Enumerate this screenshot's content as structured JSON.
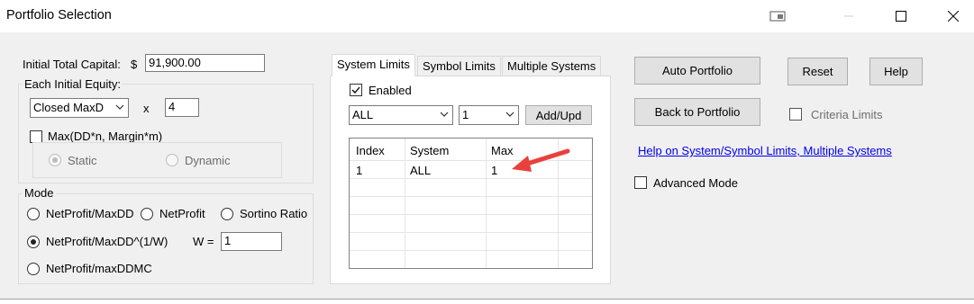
{
  "window": {
    "title": "Portfolio Selection",
    "controls": [
      "restore-icon",
      "minimize-icon",
      "maximize-icon",
      "close-icon"
    ]
  },
  "capital": {
    "label": "Initial Total Capital:",
    "currency": "$",
    "value": "91,900.00"
  },
  "equity": {
    "label": "Each Initial Equity:",
    "method": "Closed MaxD",
    "multiplier_label": "x",
    "multiplier": "4",
    "max_label": "Max(DD*n, Margin*m)",
    "max_checked": false,
    "static_label": "Static",
    "dynamic_label": "Dynamic",
    "selected": "Static"
  },
  "mode": {
    "label": "Mode",
    "options": [
      "NetProfit/MaxDD",
      "NetProfit",
      "Sortino Ratio",
      "NetProfit/MaxDD^(1/W)",
      "NetProfit/maxDDMC"
    ],
    "selected": "NetProfit/MaxDD^(1/W)",
    "w_label": "W =",
    "w_value": "1"
  },
  "tabs": {
    "items": [
      "System Limits",
      "Symbol Limits",
      "Multiple Systems"
    ],
    "active": "System Limits"
  },
  "system_limits": {
    "enabled_label": "Enabled",
    "enabled_checked": true,
    "system_select": "ALL",
    "max_select": "1",
    "add_button": "Add/Upd",
    "columns": [
      "Index",
      "System",
      "Max"
    ],
    "rows": [
      {
        "index": "1",
        "system": "ALL",
        "max": "1"
      }
    ],
    "annotation_color": "#e8413c"
  },
  "buttons": {
    "auto_portfolio": "Auto Portfolio",
    "reset": "Reset",
    "help": "Help",
    "back_to_portfolio": "Back to Portfolio"
  },
  "criteria_limits": {
    "label": "Criteria Limits",
    "checked": false
  },
  "help_link": "Help on System/Symbol Limits, Multiple Systems",
  "advanced_mode": {
    "label": "Advanced Mode",
    "checked": false
  }
}
